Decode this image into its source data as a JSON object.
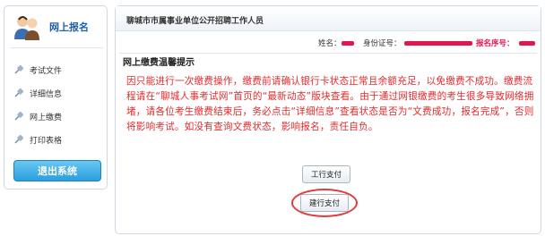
{
  "sidebar": {
    "title": "网上报名",
    "items": [
      {
        "label": "考试文件",
        "icon": "pin-icon"
      },
      {
        "label": "详细信息",
        "icon": "pin-icon"
      },
      {
        "label": "网上缴费",
        "icon": "pin-icon"
      },
      {
        "label": "打印表格",
        "icon": "pin-icon"
      }
    ],
    "exit_label": "退出系统"
  },
  "main": {
    "title": "聊城市市属事业单位公开招聘工作人员",
    "info": {
      "name_label": "姓名：",
      "id_label": "身份证号：",
      "reg_label": "报名序号："
    },
    "section_title": "网上缴费温馨提示",
    "notice": "因只能进行一次缴费操作，缴费前请确认银行卡状态正常且余额充足，以免缴费不成功。缴费流程请在“聊城人事考试网”首页的“最新动态”版块查看。由于通过网银缴费的考生很多导致网络拥堵，请各位考生缴费结束后，务必点击“详细信息”查看状态是否为“文费成功，报名完成”，否则将影响考试。如没有查询文费状态，影响报名，责任自负。",
    "buttons": {
      "icbc": "工行支付",
      "ccb": "建行支付"
    }
  },
  "colors": {
    "notice_red": "#e4292b",
    "title_blue": "#1f5fa8",
    "exit_blue": "#2a9ede",
    "highlight_red": "#e23b3b"
  }
}
